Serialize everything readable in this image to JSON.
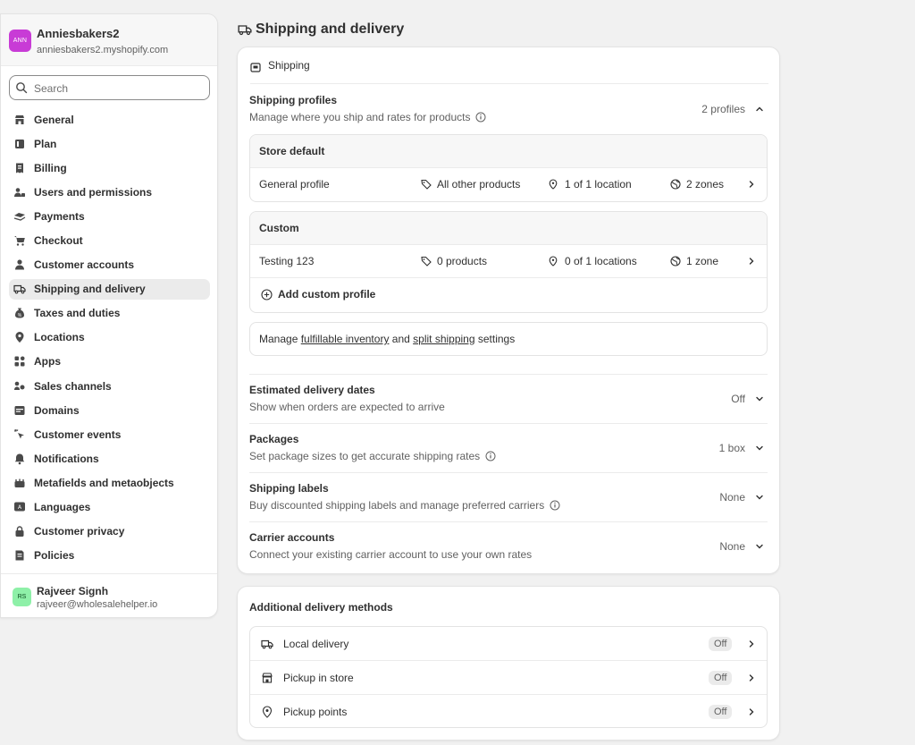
{
  "store": {
    "avatar": "ANN",
    "name": "Anniesbakers2",
    "domain": "anniesbakers2.myshopify.com"
  },
  "search": {
    "placeholder": "Search"
  },
  "nav": [
    {
      "label": "General",
      "icon": "store-icon"
    },
    {
      "label": "Plan",
      "icon": "plan-icon"
    },
    {
      "label": "Billing",
      "icon": "billing-icon"
    },
    {
      "label": "Users and permissions",
      "icon": "users-icon"
    },
    {
      "label": "Payments",
      "icon": "payments-icon"
    },
    {
      "label": "Checkout",
      "icon": "cart-icon"
    },
    {
      "label": "Customer accounts",
      "icon": "person-icon"
    },
    {
      "label": "Shipping and delivery",
      "icon": "truck-icon",
      "active": true
    },
    {
      "label": "Taxes and duties",
      "icon": "tax-icon"
    },
    {
      "label": "Locations",
      "icon": "location-icon"
    },
    {
      "label": "Apps",
      "icon": "apps-icon"
    },
    {
      "label": "Sales channels",
      "icon": "channels-icon"
    },
    {
      "label": "Domains",
      "icon": "domains-icon"
    },
    {
      "label": "Customer events",
      "icon": "cursor-icon"
    },
    {
      "label": "Notifications",
      "icon": "bell-icon"
    },
    {
      "label": "Metafields and metaobjects",
      "icon": "metafields-icon"
    },
    {
      "label": "Languages",
      "icon": "languages-icon"
    },
    {
      "label": "Customer privacy",
      "icon": "lock-icon"
    },
    {
      "label": "Policies",
      "icon": "policies-icon"
    }
  ],
  "user": {
    "avatar": "RS",
    "name": "Rajveer Signh",
    "email": "rajveer@wholesalehelper.io"
  },
  "page": {
    "title": "Shipping and delivery"
  },
  "shipping": {
    "section_label": "Shipping",
    "profiles": {
      "title": "Shipping profiles",
      "desc": "Manage where you ship and rates for products",
      "count": "2 profiles"
    },
    "store_default": {
      "header": "Store default",
      "name": "General profile",
      "products": "All other products",
      "locations": "1 of 1 location",
      "zones": "2 zones"
    },
    "custom": {
      "header": "Custom",
      "name": "Testing 123",
      "products": "0 products",
      "locations": "0 of 1 locations",
      "zones": "1 zone",
      "add_label": "Add custom profile"
    },
    "manage": {
      "prefix": "Manage",
      "link1": "fulfillable inventory",
      "mid": "and",
      "link2": "split shipping",
      "suffix": "settings"
    },
    "rows": [
      {
        "title": "Estimated delivery dates",
        "desc": "Show when orders are expected to arrive",
        "value": "Off",
        "info": false
      },
      {
        "title": "Packages",
        "desc": "Set package sizes to get accurate shipping rates",
        "value": "1 box",
        "info": true
      },
      {
        "title": "Shipping labels",
        "desc": "Buy discounted shipping labels and manage preferred carriers",
        "value": "None",
        "info": true
      },
      {
        "title": "Carrier accounts",
        "desc": "Connect your existing carrier account to use your own rates",
        "value": "None",
        "info": false
      }
    ]
  },
  "additional": {
    "title": "Additional delivery methods",
    "methods": [
      {
        "label": "Local delivery",
        "status": "Off",
        "icon": "truck-icon"
      },
      {
        "label": "Pickup in store",
        "status": "Off",
        "icon": "store-icon"
      },
      {
        "label": "Pickup points",
        "status": "Off",
        "icon": "location-icon"
      }
    ]
  }
}
